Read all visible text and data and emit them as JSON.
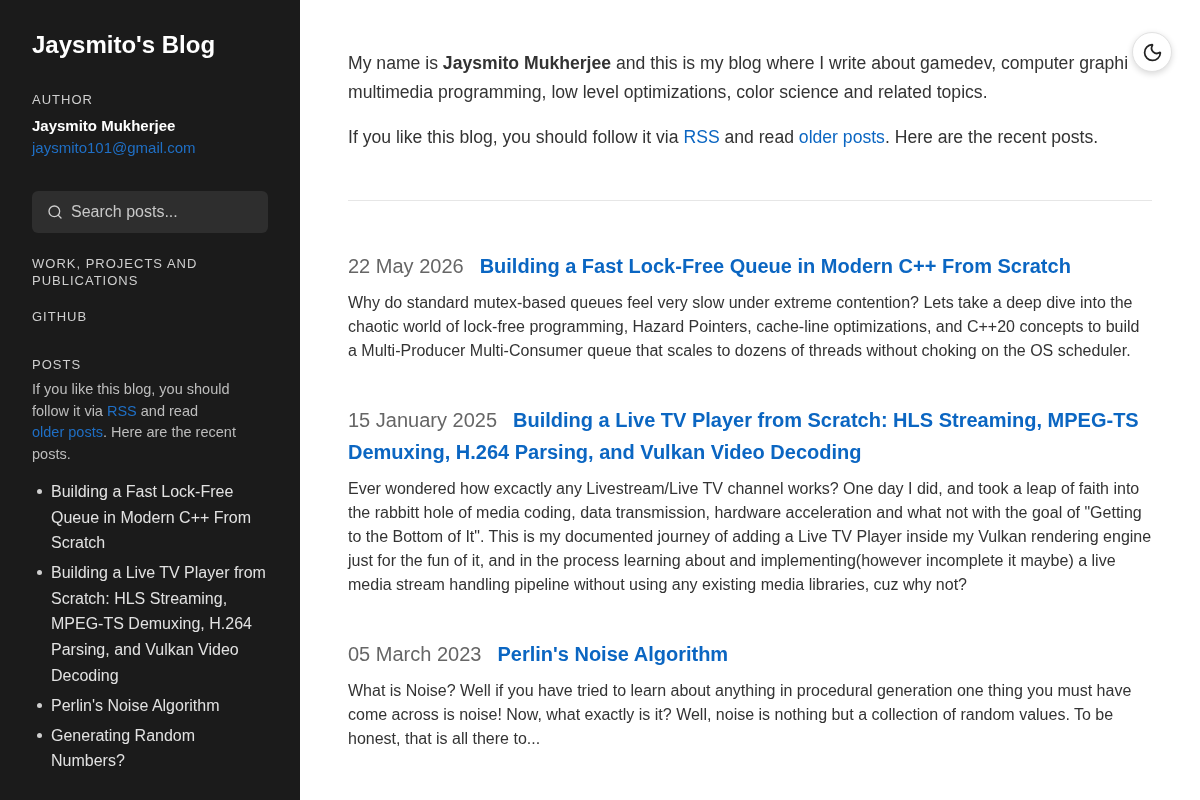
{
  "sidebar": {
    "title": "Jaysmito's Blog",
    "author": {
      "label": "AUTHOR",
      "name": "Jaysmito Mukherjee",
      "email": "jaysmito101@gmail.com"
    },
    "search": {
      "placeholder": "Search posts..."
    },
    "links": [
      "WORK, PROJECTS AND PUBLICATIONS",
      "GITHUB"
    ],
    "posts": {
      "heading": "POSTS",
      "note": [
        {
          "kind": "text",
          "text": "If you like this blog, you should follow it via "
        },
        {
          "kind": "link",
          "text": "RSS"
        },
        {
          "kind": "text",
          "text": " and read "
        },
        {
          "kind": "link",
          "text": "older posts"
        },
        {
          "kind": "text",
          "text": ". Here are the recent posts."
        }
      ],
      "items": [
        "Building a Fast Lock-Free Queue in Modern C++ From Scratch",
        "Building a Live TV Player from Scratch: HLS Streaming, MPEG-TS Demuxing, H.264 Parsing, and Vulkan Video Decoding",
        "Perlin's Noise Algorithm",
        "Generating Random Numbers?"
      ]
    }
  },
  "intro": {
    "lines": [
      "My name is **Jaysmito Mukherjee** and this is my blog where I write about gamedev, computer graphi",
      "multimedia programming, low level optimizations, color science and related topics."
    ],
    "follow": [
      {
        "kind": "text",
        "text": "If you like this blog, you should follow it via "
      },
      {
        "kind": "link",
        "text": "RSS"
      },
      {
        "kind": "text",
        "text": " and read "
      },
      {
        "kind": "link",
        "text": "older posts"
      },
      {
        "kind": "text",
        "text": ". Here are the recent posts."
      }
    ]
  },
  "posts": [
    {
      "date": "22 May 2026",
      "title": "Building a Fast Lock-Free Queue in Modern C++ From Scratch",
      "excerpt": "Why do standard mutex-based queues feel very slow under extreme contention? Lets take a deep dive into the chaotic world of lock-free programming, Hazard Pointers, cache-line optimizations, and C++20 concepts to build a Multi-Producer Multi-Consumer queue that scales to dozens of threads without choking on the OS scheduler."
    },
    {
      "date": "15 January 2025",
      "title": "Building a Live TV Player from Scratch: HLS Streaming, MPEG-TS Demuxing, H.264 Parsing, and Vulkan Video Decoding",
      "excerpt": "Ever wondered how excactly any Livestream/Live TV channel works? One day I did, and took a leap of faith into the rabbitt hole of media coding, data transmission, hardware acceleration and what not with the goal of \"Getting to the Bottom of It\". This is my documented journey of adding a Live TV Player inside my Vulkan rendering engine just for the fun of it, and in the process learning about and implementing(however incomplete it maybe) a live media stream handling pipeline without using any existing media libraries, cuz why not?"
    },
    {
      "date": "05 March 2023",
      "title": "Perlin's Noise Algorithm",
      "excerpt": "What is Noise? Well if you have tried to learn about anything in procedural generation one thing you must have come across is noise! Now, what exactly is it? Well, noise is nothing but a collection of random values. To be honest, that is all there to..."
    }
  ]
}
